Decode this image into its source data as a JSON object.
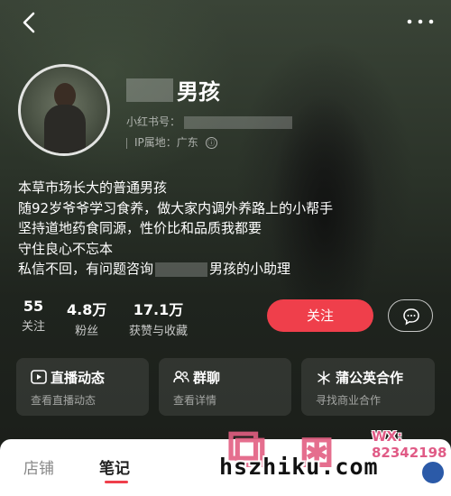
{
  "profile": {
    "name": "男孩",
    "id_label": "小红书号：",
    "ip_label": "IP属地：广东",
    "info_glyph": "ⓘ"
  },
  "bio": {
    "lines": [
      "本草市场长大的普通男孩",
      "随92岁爷爷学习食养，做大家内调外养路上的小帮手",
      "坚持道地药食同源，性价比和品质我都要",
      "守住良心不忘本"
    ],
    "last_line_prefix": "私信不回，有问题咨询",
    "last_line_suffix": "男孩的小助理"
  },
  "stats": [
    {
      "num": "55",
      "label": "关注"
    },
    {
      "num": "4.8万",
      "label": "粉丝"
    },
    {
      "num": "17.1万",
      "label": "获赞与收藏"
    }
  ],
  "actions": {
    "follow_label": "关注"
  },
  "cards": [
    {
      "title": "直播动态",
      "sub": "查看直播动态",
      "icon": "live-icon"
    },
    {
      "title": "群聊",
      "sub": "查看详情",
      "icon": "group-chat-icon"
    },
    {
      "title": "蒲公英合作",
      "sub": "寻找商业合作",
      "icon": "dandelion-icon"
    }
  ],
  "tabs": [
    {
      "label": "店铺",
      "active": false
    },
    {
      "label": "笔记",
      "active": true
    }
  ],
  "watermark": {
    "text": "hszhiku.com",
    "wx_line1": "WX:",
    "wx_line2": "82342198"
  },
  "colors": {
    "accent": "#ef3f4b",
    "watermark_pink": "#e05b86"
  }
}
